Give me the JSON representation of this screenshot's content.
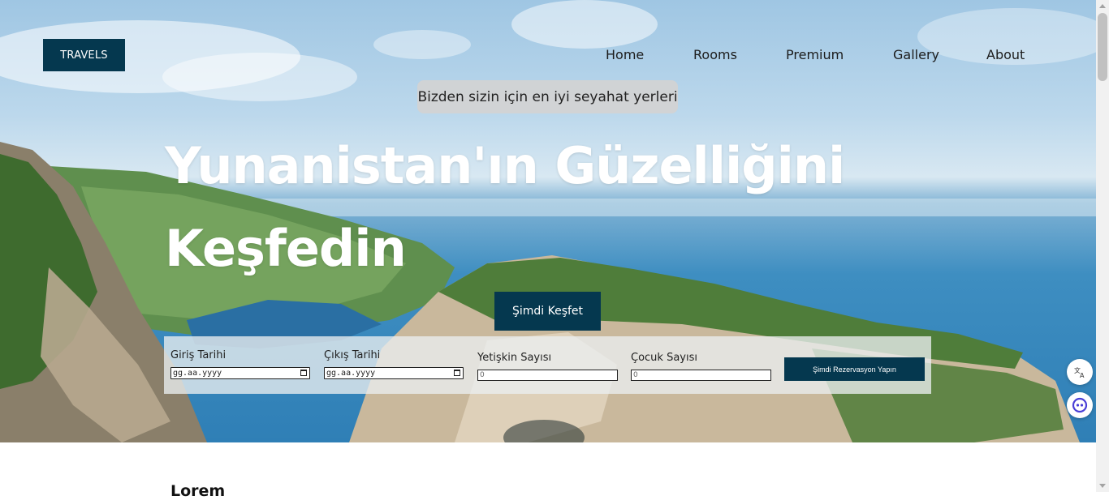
{
  "brand": {
    "logo_label": "TRAVELS",
    "accent": "#05384f"
  },
  "nav": {
    "items": [
      "Home",
      "Rooms",
      "Premium",
      "Gallery",
      "About"
    ]
  },
  "hero": {
    "tagline": "Bizden sizin için en iyi seyahat yerleri",
    "headline_line1": "Yunanistan'ın Güzelliğini",
    "headline_line2": "Keşfedin",
    "cta_label": "Şimdi Keşfet"
  },
  "booking": {
    "checkin_label": "Giriş Tarihi",
    "checkin_placeholder": "gg.aa.yyyy",
    "checkout_label": "Çıkış Tarihi",
    "checkout_placeholder": "gg.aa.yyyy",
    "adults_label": "Yetişkin Sayısı",
    "adults_value": "0",
    "children_label": "Çocuk Sayısı",
    "children_value": "0",
    "submit_label": "Şimdi Rezervasyon Yapın"
  },
  "floating": {
    "translate_icon": "translate-icon",
    "assistant_icon": "assistant-icon"
  },
  "content": {
    "heading_visible": "Lorem",
    "body_visible": ""
  }
}
